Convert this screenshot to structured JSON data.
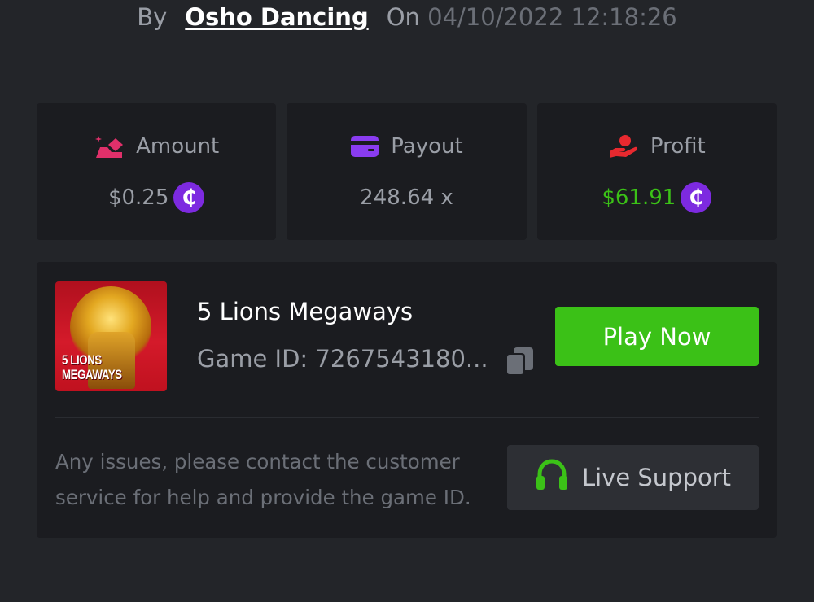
{
  "byline": {
    "by_label": "By",
    "username": "Osho Dancing",
    "on_label": "On",
    "datetime": "04/10/2022 12:18:26"
  },
  "stats": {
    "amount": {
      "label": "Amount",
      "value": "$0.25",
      "icon": "bet-amount-icon",
      "currency_icon": "coin-icon"
    },
    "payout": {
      "label": "Payout",
      "value": "248.64 x",
      "icon": "card-icon"
    },
    "profit": {
      "label": "Profit",
      "value": "$61.91",
      "icon": "hand-profit-icon",
      "currency_icon": "coin-icon",
      "value_color": "#3bc117"
    }
  },
  "coin_symbol": "₵",
  "game": {
    "thumbnail_text": [
      "5 LIONS",
      "MEGAWAYS"
    ],
    "title": "5 Lions Megaways",
    "game_id_text": "Game ID: 7267543180...",
    "play_button": "Play Now",
    "help_text": "Any issues, please contact the customer service for help and provide the game ID.",
    "support_button": "Live Support"
  },
  "colors": {
    "background": "#232529",
    "card": "#1b1c20",
    "accent_green": "#3bc117",
    "coin_purple": "#7d2ae0",
    "amount_icon": "#e0306a",
    "payout_icon": "#8a3cf0",
    "profit_icon": "#e8292f"
  }
}
